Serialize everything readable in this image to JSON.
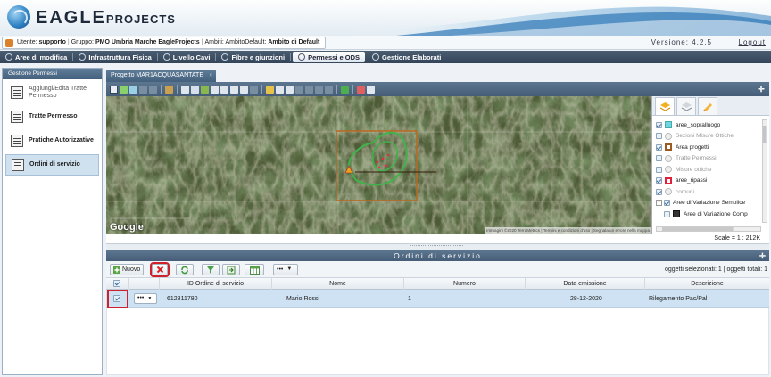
{
  "header": {
    "brand_main": "EAGLE",
    "brand_sub": "PROJECTS"
  },
  "userbar": {
    "utente_label": "Utente:",
    "utente_value": "supporto",
    "gruppo_label": "Gruppo:",
    "gruppo_value": "PMO Umbria Marche EagleProjects",
    "ambiti_label": "Ambiti:",
    "ambiti_value": "AmbitoDefault:",
    "ambito_value": "Ambito di Default",
    "version": "Versione: 4.2.5",
    "logout": "Logout"
  },
  "nav": {
    "items": [
      {
        "label": "Aree di modifica"
      },
      {
        "label": "Infrastruttura Fisica"
      },
      {
        "label": "Livello Cavi"
      },
      {
        "label": "Fibre e giunzioni"
      },
      {
        "label": "Permessi e ODS"
      },
      {
        "label": "Gestione Elaborati"
      }
    ]
  },
  "sidebar": {
    "title": "Gestione Permessi",
    "items": [
      {
        "label": "Aggiungi/Edita Tratte Permesso"
      },
      {
        "label": "Tratte Permesso"
      },
      {
        "label": "Pratiche Autorizzative"
      },
      {
        "label": "Ordini di servizio"
      }
    ]
  },
  "project_tab": {
    "label": "Progetto MAR1ACQUASANTATE",
    "close": "×"
  },
  "map": {
    "google_logo": "Google",
    "attribution": "Immagini ©2020 TerraMetrics | Termini e condizioni d'uso | Segnala un errore nella mappa",
    "scale": "Scale = 1 : 212K"
  },
  "layers": {
    "items": [
      {
        "label": "aree_sopralluogo",
        "checked": true,
        "color": "#6fd6e0"
      },
      {
        "label": "Sezioni Misure Ottiche",
        "checked": false,
        "color": ""
      },
      {
        "label": "Area progetti",
        "checked": true,
        "color": "#9b5a1e"
      },
      {
        "label": "Tratte Permessi",
        "checked": false,
        "color": ""
      },
      {
        "label": "Misure ottiche",
        "checked": false,
        "color": ""
      },
      {
        "label": "aree_ripassi",
        "checked": true,
        "color": "#e0203a"
      },
      {
        "label": "comuni",
        "checked": true,
        "color": ""
      },
      {
        "label": "Aree di Variazione Semplice",
        "checked": true,
        "color": ""
      },
      {
        "label": "Aree di Variazione Comp",
        "checked": false,
        "color": "#333333"
      }
    ]
  },
  "grid": {
    "title": "Ordini di servizio",
    "new_button": "Nuovo",
    "more_button": "•••",
    "selection_info": "oggetti selezionati: 1 | oggetti totali: 1",
    "columns": [
      "ID Ordine di servizio",
      "Nome",
      "Numero",
      "Data emissione",
      "Descrizione"
    ],
    "rows": [
      {
        "id": "612811780",
        "nome": "Mario Rossi",
        "numero": "1",
        "data": "28-12-2020",
        "descrizione": "Rilegamento Pac/Pal",
        "selected": true
      }
    ]
  }
}
